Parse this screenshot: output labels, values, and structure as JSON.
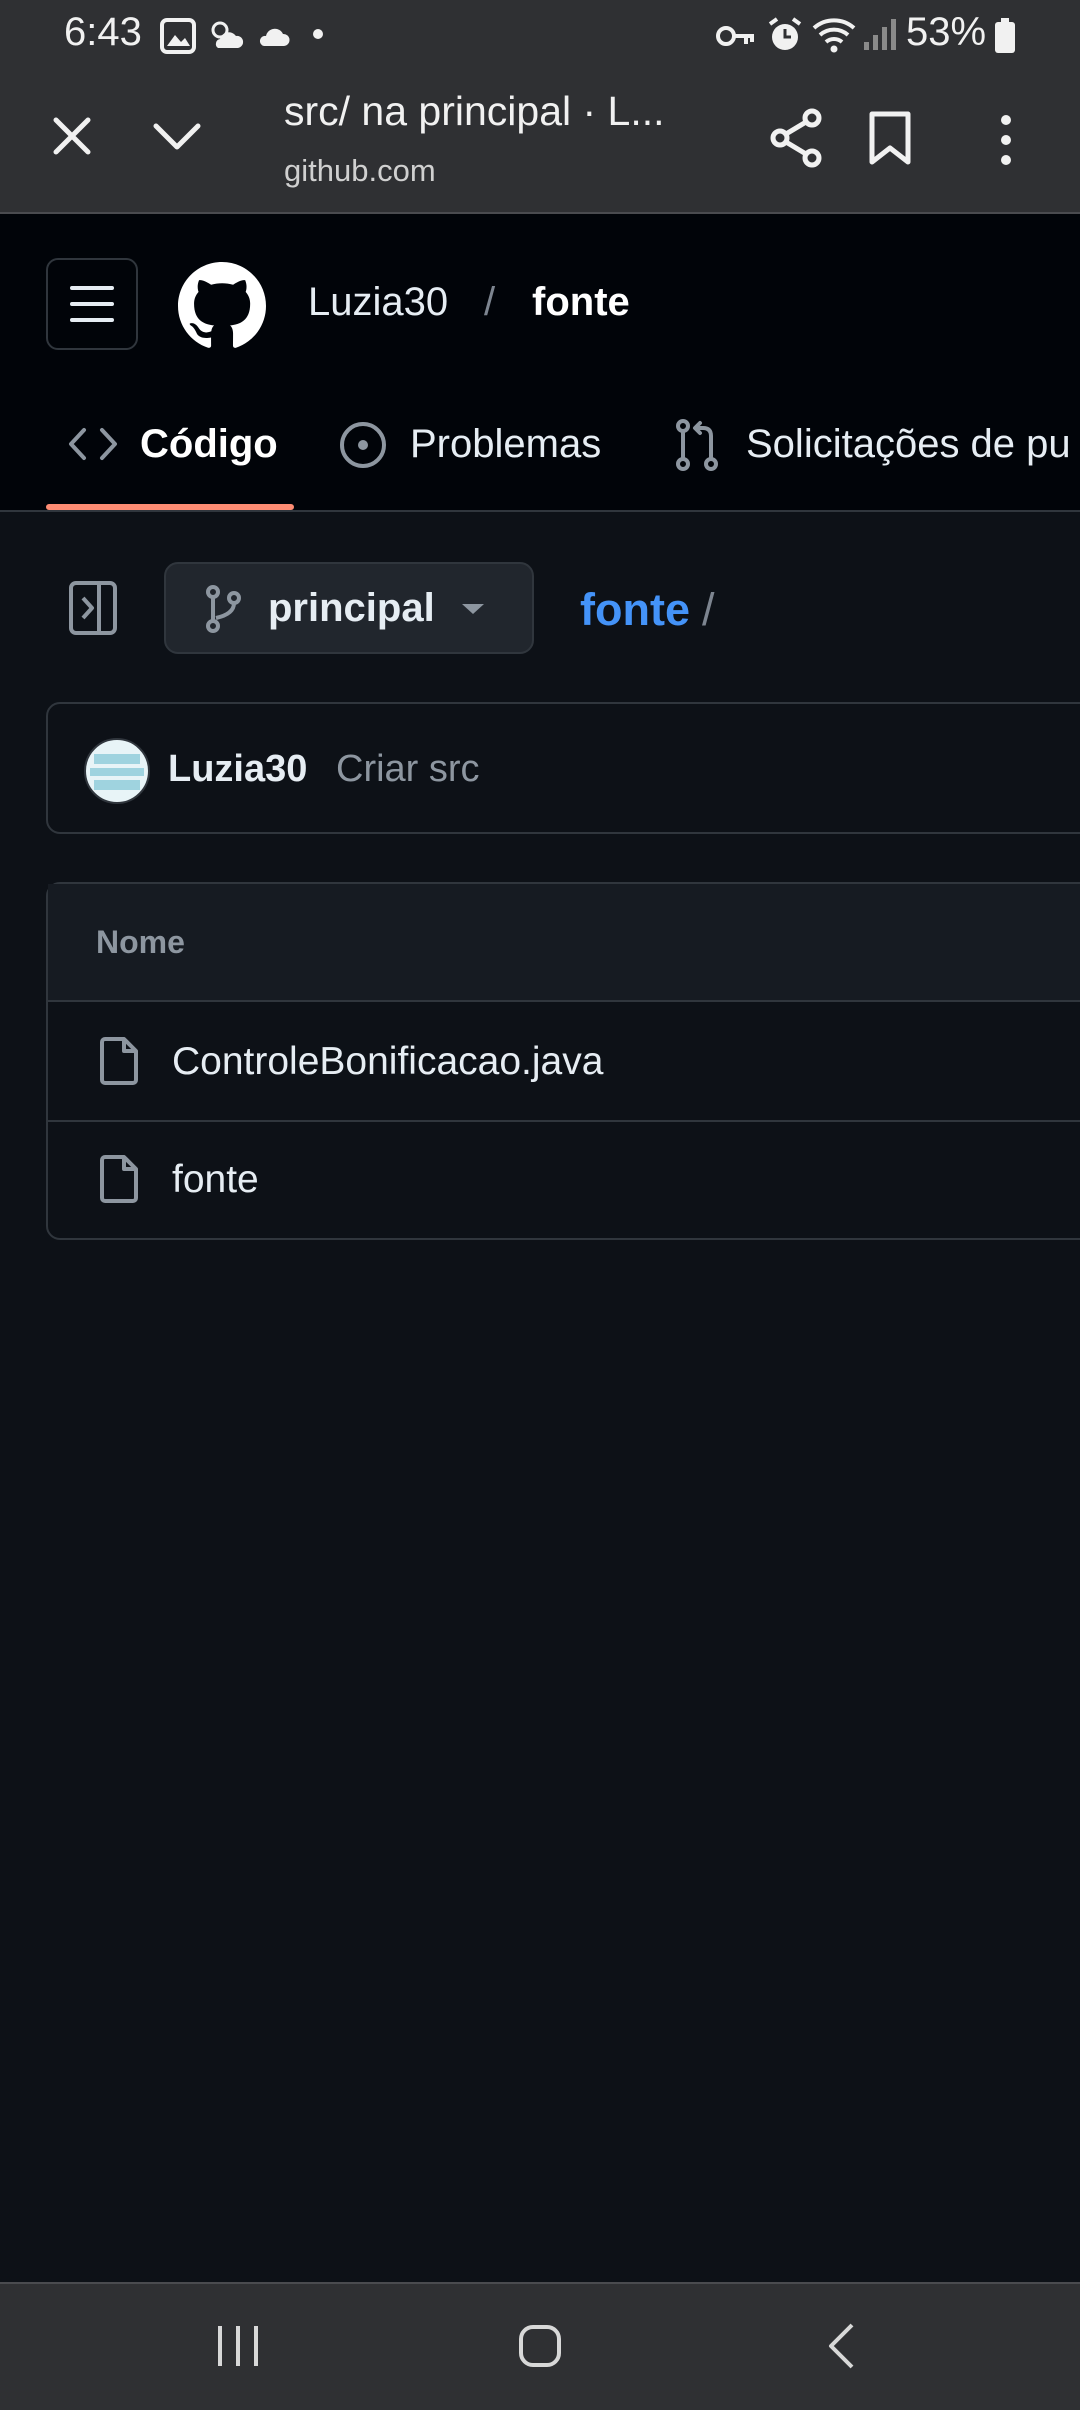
{
  "status_bar": {
    "time": "6:43",
    "battery": "53%"
  },
  "browser": {
    "title": "src/ na principal · L...",
    "url": "github.com"
  },
  "header": {
    "owner": "Luzia30",
    "separator": "/",
    "repo": "fonte"
  },
  "tabs": [
    {
      "label": "Código",
      "active": true
    },
    {
      "label": "Problemas",
      "active": false
    },
    {
      "label": "Solicitações de pu",
      "active": false
    }
  ],
  "branch": {
    "name": "principal"
  },
  "breadcrumb": {
    "root": "fonte",
    "separator": "/"
  },
  "commit": {
    "author": "Luzia30",
    "message": "Criar src"
  },
  "files": {
    "header": "Nome",
    "items": [
      {
        "name": "ControleBonificacao.java"
      },
      {
        "name": "fonte"
      }
    ]
  },
  "colors": {
    "accent_link": "#4493f8",
    "tab_underline": "#fd8c73",
    "background": "#0d1117"
  }
}
